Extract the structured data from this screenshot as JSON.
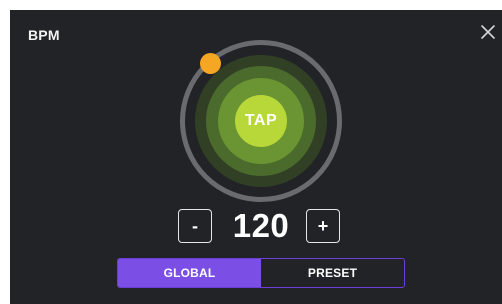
{
  "dialog": {
    "title": "BPM",
    "close_icon": "close-icon"
  },
  "tap": {
    "label": "TAP"
  },
  "bpm": {
    "minus_label": "-",
    "value": "120",
    "plus_label": "+"
  },
  "mode": {
    "options": [
      "GLOBAL",
      "PRESET"
    ],
    "selected": "GLOBAL"
  },
  "colors": {
    "background": "#222326",
    "knob": "#f5a623",
    "tap": "#b8d83a",
    "accent": "#7b4ee6"
  }
}
